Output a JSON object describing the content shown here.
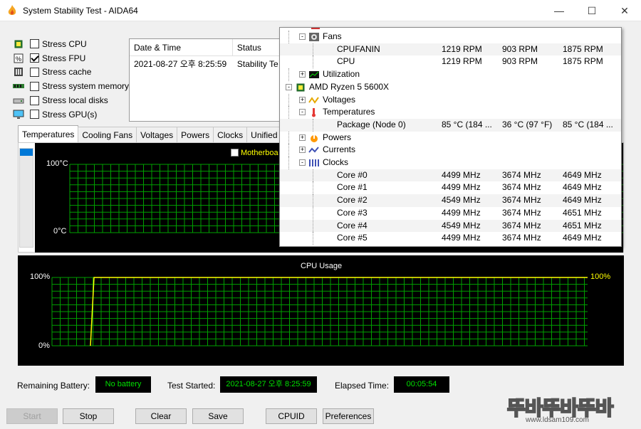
{
  "window": {
    "title": "System Stability Test - AIDA64"
  },
  "stress_items": [
    {
      "label": "Stress CPU",
      "checked": false,
      "icon": "cpu-chip-icon"
    },
    {
      "label": "Stress FPU",
      "checked": true,
      "icon": "fpu-icon"
    },
    {
      "label": "Stress cache",
      "checked": false,
      "icon": "cache-icon"
    },
    {
      "label": "Stress system memory",
      "checked": false,
      "icon": "memory-icon"
    },
    {
      "label": "Stress local disks",
      "checked": false,
      "icon": "disk-icon"
    },
    {
      "label": "Stress GPU(s)",
      "checked": false,
      "icon": "monitor-icon"
    }
  ],
  "log": {
    "headers": [
      "Date & Time",
      "Status"
    ],
    "rows": [
      [
        "2021-08-27 오후 8:25:59",
        "Stability Te"
      ]
    ]
  },
  "tabs": [
    "Temperatures",
    "Cooling Fans",
    "Voltages",
    "Powers",
    "Clocks",
    "Unified"
  ],
  "temp_chart": {
    "legend_item": "Motherboa",
    "y_top": "100°C",
    "y_bottom": "0°C"
  },
  "cpu_chart": {
    "title": "CPU Usage",
    "y_top": "100%",
    "y_bottom": "0%",
    "current": "100%"
  },
  "chart_data": {
    "type": "line",
    "title": "CPU Usage",
    "ylim": [
      0,
      100
    ],
    "y_ticks": [
      "0%",
      "100%"
    ],
    "series": [
      {
        "values": [
          0,
          100,
          100,
          100,
          100,
          100,
          100,
          100,
          100,
          100,
          100,
          100
        ]
      }
    ],
    "grid": true,
    "colors": {
      "line": "#ffff00",
      "grid": "#00a000",
      "background": "#000000"
    }
  },
  "sensors": {
    "rows": [
      {
        "label": "Fans",
        "level": 1,
        "expander": "-",
        "icon": "fan-icon",
        "vals": []
      },
      {
        "label": "CPUFANIN",
        "level": 2,
        "vals": [
          "1219 RPM",
          "903 RPM",
          "1875 RPM"
        ],
        "alt": true
      },
      {
        "label": "CPU",
        "level": 2,
        "vals": [
          "1219 RPM",
          "903 RPM",
          "1875 RPM"
        ]
      },
      {
        "label": "Utilization",
        "level": 1,
        "expander": "+",
        "icon": "utilization-icon",
        "vals": []
      },
      {
        "label": "AMD Ryzen 5 5600X",
        "level": 0,
        "expander": "-",
        "icon": "cpu-chip-icon",
        "vals": []
      },
      {
        "label": "Voltages",
        "level": 1,
        "expander": "+",
        "icon": "voltage-icon",
        "vals": []
      },
      {
        "label": "Temperatures",
        "level": 1,
        "expander": "-",
        "icon": "thermometer-icon",
        "vals": []
      },
      {
        "label": "Package (Node 0)",
        "level": 2,
        "vals": [
          "85 °C  (184 ...",
          "36 °C  (97 °F)",
          "85 °C  (184 ..."
        ],
        "alt": true
      },
      {
        "label": "Powers",
        "level": 1,
        "expander": "+",
        "icon": "power-icon",
        "vals": []
      },
      {
        "label": "Currents",
        "level": 1,
        "expander": "+",
        "icon": "current-icon",
        "vals": []
      },
      {
        "label": "Clocks",
        "level": 1,
        "expander": "-",
        "icon": "clock-icon",
        "vals": []
      },
      {
        "label": "Core #0",
        "level": 2,
        "vals": [
          "4499 MHz",
          "3674 MHz",
          "4649 MHz"
        ],
        "alt": true
      },
      {
        "label": "Core #1",
        "level": 2,
        "vals": [
          "4499 MHz",
          "3674 MHz",
          "4649 MHz"
        ]
      },
      {
        "label": "Core #2",
        "level": 2,
        "vals": [
          "4549 MHz",
          "3674 MHz",
          "4649 MHz"
        ],
        "alt": true
      },
      {
        "label": "Core #3",
        "level": 2,
        "vals": [
          "4499 MHz",
          "3674 MHz",
          "4651 MHz"
        ]
      },
      {
        "label": "Core #4",
        "level": 2,
        "vals": [
          "4549 MHz",
          "3674 MHz",
          "4651 MHz"
        ],
        "alt": true
      },
      {
        "label": "Core #5",
        "level": 2,
        "vals": [
          "4499 MHz",
          "3674 MHz",
          "4649 MHz"
        ]
      }
    ]
  },
  "status": {
    "battery_label": "Remaining Battery:",
    "battery_value": "No battery",
    "started_label": "Test Started:",
    "started_value": "2021-08-27 오후 8:25:59",
    "elapsed_label": "Elapsed Time:",
    "elapsed_value": "00:05:54"
  },
  "buttons": {
    "start": "Start",
    "stop": "Stop",
    "clear": "Clear",
    "save": "Save",
    "cpuid": "CPUID",
    "preferences": "Preferences"
  },
  "watermark": {
    "text": "뚜바뚜바뚜바",
    "url": "www.ldsam109.com"
  }
}
